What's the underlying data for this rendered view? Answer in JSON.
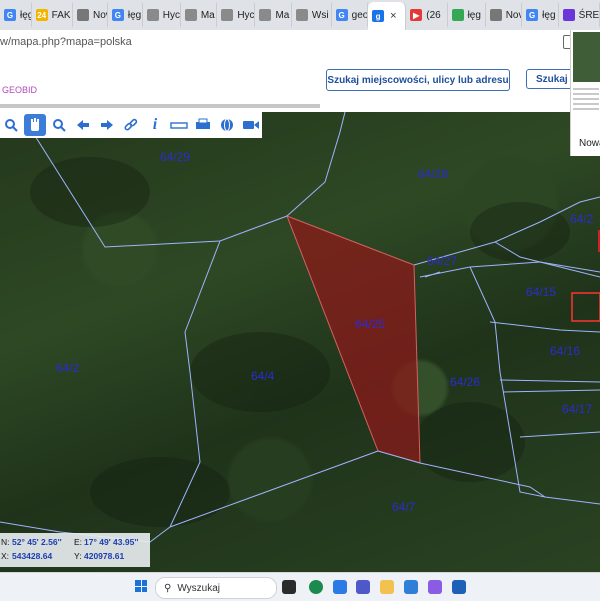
{
  "tabs": [
    {
      "label": "łęg",
      "fav": "G",
      "color": "#4285f4"
    },
    {
      "label": "FAK",
      "fav": "24",
      "color": "#f4b400"
    },
    {
      "label": "Nov",
      "fav": "",
      "color": "#777777"
    },
    {
      "label": "łęg",
      "fav": "G",
      "color": "#4285f4"
    },
    {
      "label": "Hyc",
      "fav": "",
      "color": "#8a8a8a"
    },
    {
      "label": "Ma",
      "fav": "",
      "color": "#8a8a8a"
    },
    {
      "label": "Hyc",
      "fav": "",
      "color": "#8a8a8a"
    },
    {
      "label": "Ma",
      "fav": "",
      "color": "#8a8a8a"
    },
    {
      "label": "Wsi",
      "fav": "",
      "color": "#8a8a8a"
    },
    {
      "label": "geo",
      "fav": "G",
      "color": "#4285f4"
    },
    {
      "label": "g",
      "fav": "g",
      "color": "#1a73e8",
      "active": true
    },
    {
      "label": "(26",
      "fav": "▶",
      "color": "#e53935"
    },
    {
      "label": "łęg",
      "fav": "",
      "color": "#34a853"
    },
    {
      "label": "Nov",
      "fav": "",
      "color": "#777777"
    },
    {
      "label": "łęg",
      "fav": "G",
      "color": "#4285f4"
    },
    {
      "label": "ŚRE",
      "fav": "",
      "color": "#6a35d9"
    }
  ],
  "address": {
    "url": "w/mapa.php?mapa=polska"
  },
  "header": {
    "brand": "GEOBID",
    "search_button": "Szukaj miejscowości, ulicy lub adresu",
    "search_button2": "Szukaj d"
  },
  "sidepanel": {
    "label": "Nowa"
  },
  "parcels": [
    {
      "id": "64/29",
      "color": "#2c2cd0"
    },
    {
      "id": "64/28",
      "color": "#2c2cd0"
    },
    {
      "id": "64/27",
      "color": "#2c2cd0"
    },
    {
      "id": "64/25",
      "color": "#2c2cd0"
    },
    {
      "id": "64/15",
      "color": "#2c2cd0"
    },
    {
      "id": "64/16",
      "color": "#2c2cd0"
    },
    {
      "id": "64/2",
      "color": "#2c2cd0"
    },
    {
      "id": "64/4",
      "color": "#2c2cd0"
    },
    {
      "id": "64/26",
      "color": "#2c2cd0"
    },
    {
      "id": "64/17",
      "color": "#2c2cd0"
    },
    {
      "id": "64/7",
      "color": "#2c2cd0"
    },
    {
      "id": "64/2",
      "color": "#2c2cd0"
    }
  ],
  "coords": {
    "n_label": "N:",
    "n_val": "52° 45' 2.56''",
    "e_label": "E:",
    "e_val": "17° 49' 43.95''",
    "x_label": "X:",
    "x_val": "543428.64",
    "y_label": "Y:",
    "y_val": "420978.61"
  },
  "taskbar": {
    "search_placeholder": "Wyszukaj"
  },
  "colors": {
    "selected_fill": "#8b1a1a",
    "parcel_line": "#9fb4ff",
    "label": "#2c2cd0",
    "toolbar_active": "#3b7dd8"
  }
}
